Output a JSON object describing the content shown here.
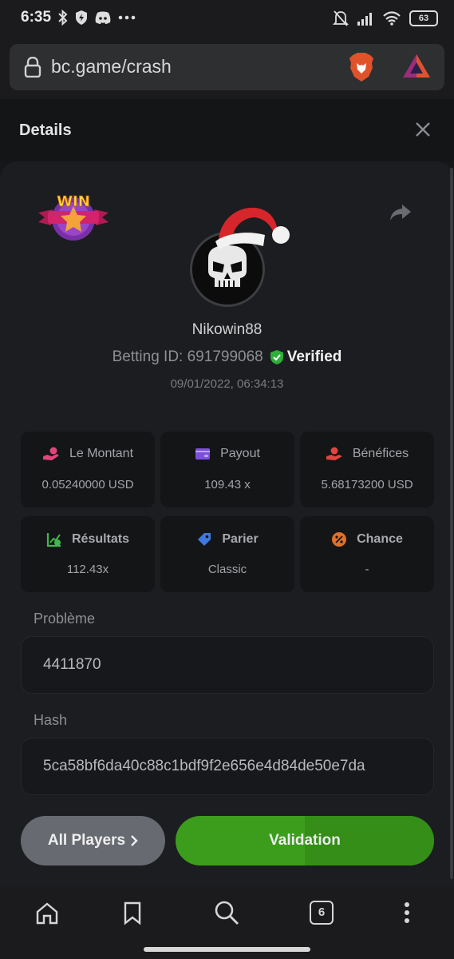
{
  "status_bar": {
    "time": "6:35",
    "battery": "63"
  },
  "browser": {
    "url": "bc.game/crash",
    "tab_count": "6"
  },
  "details": {
    "title": "Details",
    "username": "Nikowin88",
    "betting_id_label": "Betting ID: 691799068",
    "verified_label": "Verified",
    "date": "09/01/2022, 06:34:13",
    "badge_text": "WIN"
  },
  "stats": [
    {
      "label": "Le Montant",
      "value": "0.05240000 USD",
      "icon": "coins-hand-icon",
      "color": "#e0457b"
    },
    {
      "label": "Payout",
      "value": "109.43 x",
      "icon": "wallet-icon",
      "color": "#7c4fe0"
    },
    {
      "label": "Bénéfices",
      "value": "5.68173200 USD",
      "icon": "money-hand-icon",
      "color": "#e0453f"
    },
    {
      "label": "Résultats",
      "value": "112.43x",
      "icon": "chart-check-icon",
      "color": "#3fb84a"
    },
    {
      "label": "Parier",
      "value": "Classic",
      "icon": "tag-icon",
      "color": "#3f78e0"
    },
    {
      "label": "Chance",
      "value": "-",
      "icon": "percent-icon",
      "color": "#e0702a"
    }
  ],
  "fields": {
    "probleme_label": "Problème",
    "probleme_value": "4411870",
    "hash_label": "Hash",
    "hash_value": "5ca58bf6da40c88c1bdf9f2e656e4d84de50e7da"
  },
  "buttons": {
    "all_players": "All Players",
    "validation": "Validation"
  },
  "colors": {
    "accent_green": "#3c9d1d",
    "verified_green": "#2fae3a",
    "panel": "#1c1d20"
  }
}
